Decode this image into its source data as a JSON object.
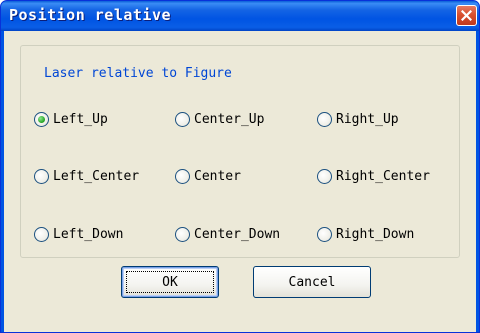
{
  "window": {
    "title": "Position relative",
    "close_icon": "close-icon",
    "title_bar_color": "#0054e3",
    "close_button_color": "#d9502f"
  },
  "group": {
    "label": "Laser relative to Figure",
    "label_color": "#0046d5"
  },
  "options": [
    {
      "label": "Left_Up",
      "checked": true
    },
    {
      "label": "Center_Up",
      "checked": false
    },
    {
      "label": "Right_Up",
      "checked": false
    },
    {
      "label": "Left_Center",
      "checked": false
    },
    {
      "label": "Center",
      "checked": false
    },
    {
      "label": "Right_Center",
      "checked": false
    },
    {
      "label": "Left_Down",
      "checked": false
    },
    {
      "label": "Center_Down",
      "checked": false
    },
    {
      "label": "Right_Down",
      "checked": false
    }
  ],
  "buttons": {
    "ok_label": "OK",
    "cancel_label": "Cancel"
  }
}
